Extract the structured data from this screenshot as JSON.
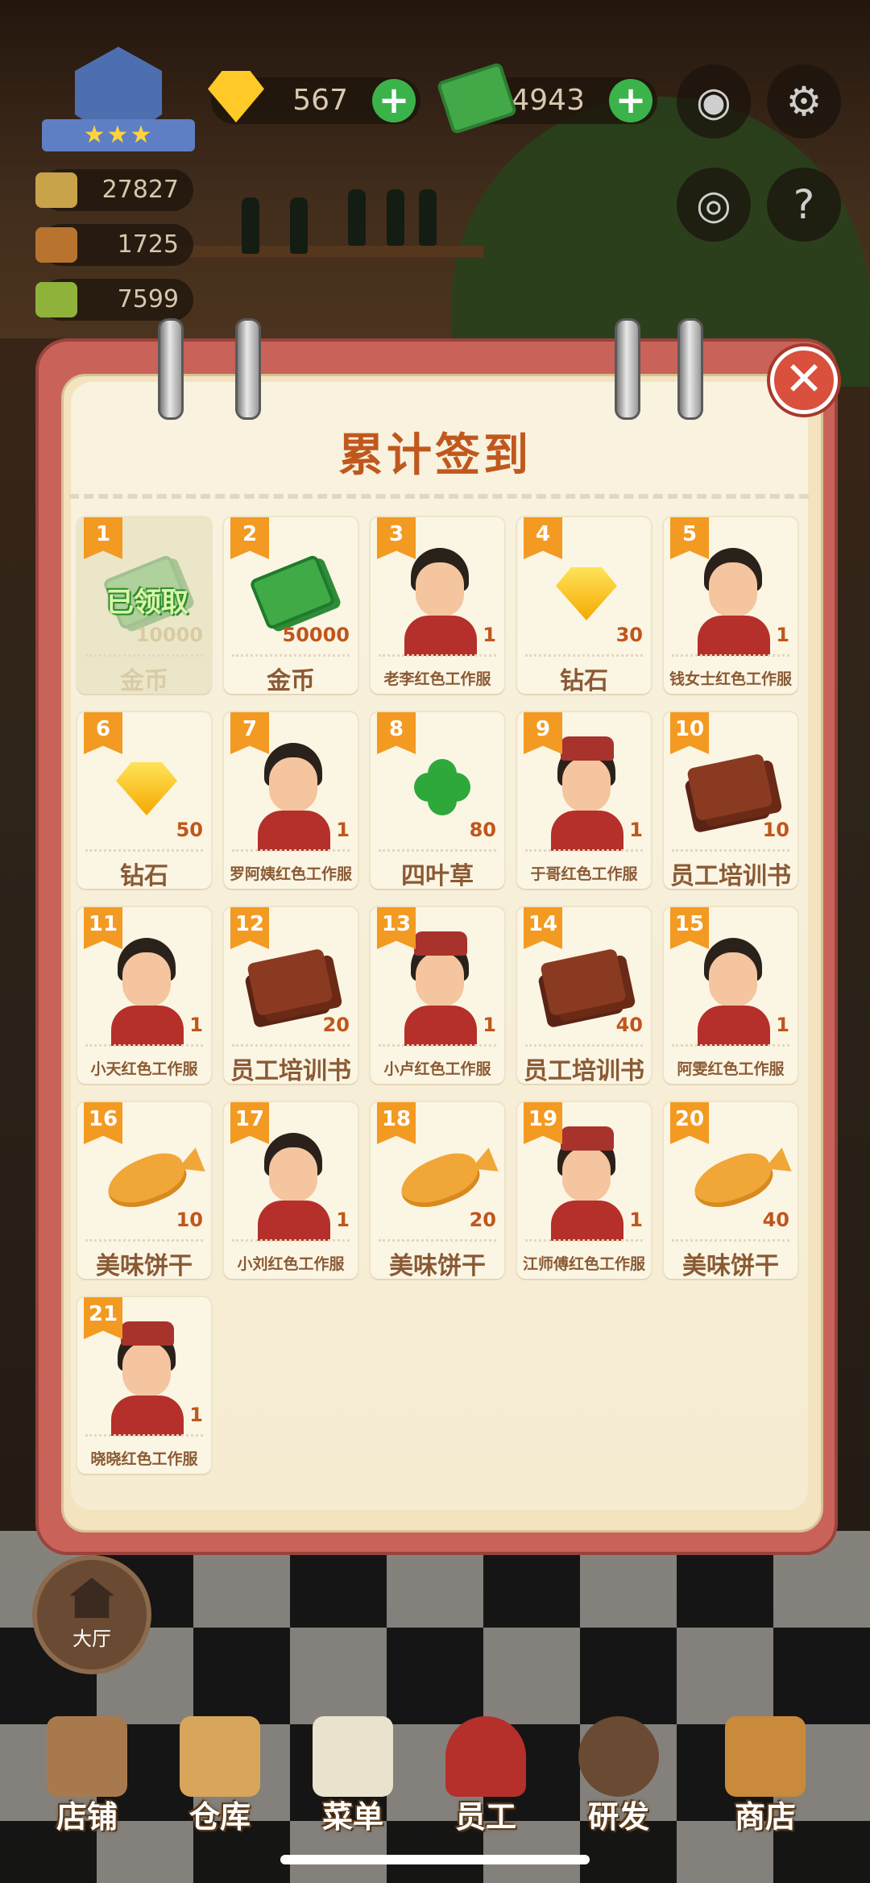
{
  "hud": {
    "gems": "567",
    "cash": "504943",
    "stats": [
      "27827",
      "1725",
      "7599"
    ],
    "stars": "★★★"
  },
  "modal": {
    "title": "累计签到",
    "close_glyph": "✕",
    "claimed_text": "已领取",
    "rewards": [
      {
        "day": "1",
        "qty": "10000",
        "name": "金币",
        "kind": "cash",
        "claimed": true
      },
      {
        "day": "2",
        "qty": "50000",
        "name": "金币",
        "kind": "cash",
        "claimed": false
      },
      {
        "day": "3",
        "qty": "1",
        "name": "老李红色工作服",
        "kind": "person",
        "claimed": false
      },
      {
        "day": "4",
        "qty": "30",
        "name": "钻石",
        "kind": "gem",
        "claimed": false
      },
      {
        "day": "5",
        "qty": "1",
        "name": "钱女士红色工作服",
        "kind": "person",
        "claimed": false
      },
      {
        "day": "6",
        "qty": "50",
        "name": "钻石",
        "kind": "gem",
        "claimed": false
      },
      {
        "day": "7",
        "qty": "1",
        "name": "罗阿姨红色工作服",
        "kind": "person",
        "claimed": false
      },
      {
        "day": "8",
        "qty": "80",
        "name": "四叶草",
        "kind": "clover",
        "claimed": false
      },
      {
        "day": "9",
        "qty": "1",
        "name": "于哥红色工作服",
        "kind": "person-hat",
        "claimed": false
      },
      {
        "day": "10",
        "qty": "10",
        "name": "员工培训书",
        "kind": "book",
        "claimed": false
      },
      {
        "day": "11",
        "qty": "1",
        "name": "小天红色工作服",
        "kind": "person",
        "claimed": false
      },
      {
        "day": "12",
        "qty": "20",
        "name": "员工培训书",
        "kind": "book",
        "claimed": false
      },
      {
        "day": "13",
        "qty": "1",
        "name": "小卢红色工作服",
        "kind": "person-hat",
        "claimed": false
      },
      {
        "day": "14",
        "qty": "40",
        "name": "员工培训书",
        "kind": "book",
        "claimed": false
      },
      {
        "day": "15",
        "qty": "1",
        "name": "阿雯红色工作服",
        "kind": "person",
        "claimed": false
      },
      {
        "day": "16",
        "qty": "10",
        "name": "美味饼干",
        "kind": "fish",
        "claimed": false
      },
      {
        "day": "17",
        "qty": "1",
        "name": "小刘红色工作服",
        "kind": "person",
        "claimed": false
      },
      {
        "day": "18",
        "qty": "20",
        "name": "美味饼干",
        "kind": "fish",
        "claimed": false
      },
      {
        "day": "19",
        "qty": "1",
        "name": "江师傅红色工作服",
        "kind": "person-hat",
        "claimed": false
      },
      {
        "day": "20",
        "qty": "40",
        "name": "美味饼干",
        "kind": "fish",
        "claimed": false
      },
      {
        "day": "21",
        "qty": "1",
        "name": "晓晓红色工作服",
        "kind": "person-hat",
        "claimed": false
      }
    ]
  },
  "hall_label": "大厅",
  "nav": [
    "店铺",
    "仓库",
    "菜单",
    "员工",
    "研发",
    "商店"
  ],
  "colors": {
    "accent": "#f39a22",
    "title": "#c0581e",
    "modal_frame": "#c9635a",
    "close": "#d9503c"
  }
}
